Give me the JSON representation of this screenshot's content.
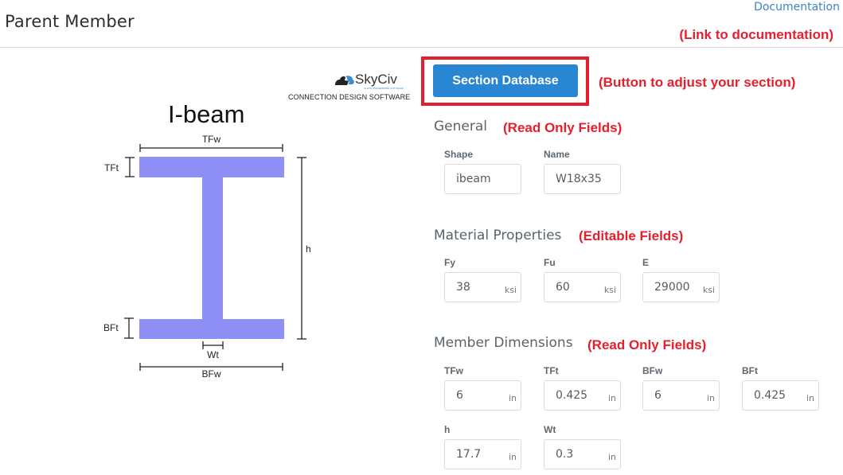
{
  "header": {
    "title": "Parent Member",
    "documentation_link": "Documentation"
  },
  "annotations": {
    "documentation": "(Link to documentation)",
    "section_button": "(Button to adjust your section)",
    "general": "(Read Only Fields)",
    "material": "(Editable Fields)",
    "dimensions": "(Read Only Fields)"
  },
  "logo": {
    "name": "SkyCiv",
    "subtitle": "CLOUD ENGINEERING SOFTWARE",
    "tagline": "CONNECTION DESIGN SOFTWARE"
  },
  "diagram": {
    "title": "I-beam",
    "labels": {
      "tfw": "TFw",
      "tft": "TFt",
      "h": "h",
      "bft": "BFt",
      "wt": "Wt",
      "bfw": "BFw"
    },
    "fill_color": "#8f90f5"
  },
  "section_button": {
    "label": "Section Database",
    "color": "#2986d2"
  },
  "general": {
    "title": "General",
    "fields": [
      {
        "label": "Shape",
        "value": "ibeam",
        "unit": ""
      },
      {
        "label": "Name",
        "value": "W18x35",
        "unit": ""
      }
    ]
  },
  "material": {
    "title": "Material Properties",
    "fields": [
      {
        "label": "Fy",
        "value": "38",
        "unit": "ksi"
      },
      {
        "label": "Fu",
        "value": "60",
        "unit": "ksi"
      },
      {
        "label": "E",
        "value": "29000",
        "unit": "ksi"
      }
    ]
  },
  "dimensions": {
    "title": "Member Dimensions",
    "fields": [
      {
        "label": "TFw",
        "value": "6",
        "unit": "in"
      },
      {
        "label": "TFt",
        "value": "0.425",
        "unit": "in"
      },
      {
        "label": "BFw",
        "value": "6",
        "unit": "in"
      },
      {
        "label": "BFt",
        "value": "0.425",
        "unit": "in"
      },
      {
        "label": "h",
        "value": "17.7",
        "unit": "in"
      },
      {
        "label": "Wt",
        "value": "0.3",
        "unit": "in"
      }
    ]
  }
}
